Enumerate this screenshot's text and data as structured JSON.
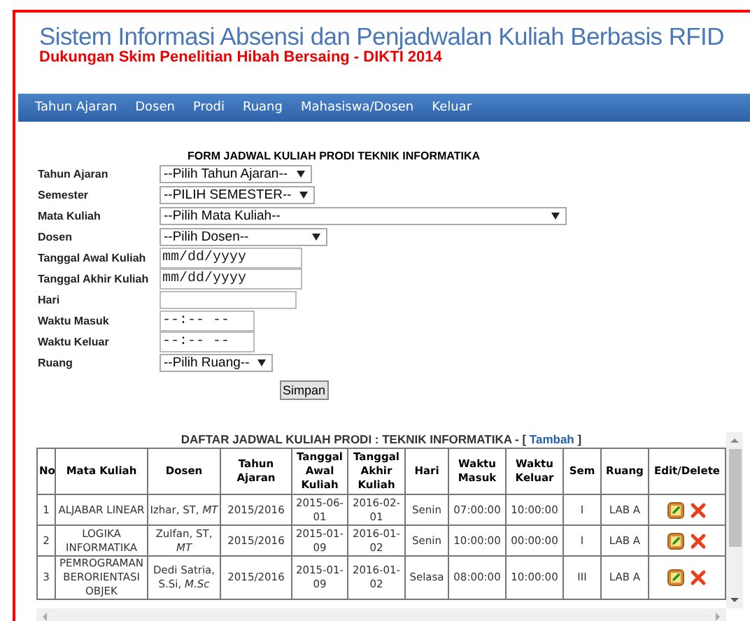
{
  "header": {
    "title": "Sistem Informasi Absensi dan Penjadwalan Kuliah Berbasis RFID",
    "subtitle": "Dukungan Skim Penelitian Hibah Bersaing - DIKTI 2014"
  },
  "nav": {
    "items": [
      "Tahun Ajaran",
      "Dosen",
      "Prodi",
      "Ruang",
      "Mahasiswa/Dosen",
      "Keluar"
    ]
  },
  "form": {
    "heading": "FORM JADWAL KULIAH PRODI TEKNIK INFORMATIKA",
    "fields": [
      {
        "label": "Tahun Ajaran",
        "kind": "select",
        "value": "--Pilih Tahun Ajaran--"
      },
      {
        "label": "Semester",
        "kind": "select",
        "value": "--PILIH SEMESTER--"
      },
      {
        "label": "Mata Kuliah",
        "kind": "select",
        "value": "--Pilih Mata Kuliah--"
      },
      {
        "label": "Dosen",
        "kind": "select",
        "value": "--Pilih Dosen--"
      },
      {
        "label": "Tanggal Awal Kuliah",
        "kind": "date",
        "placeholder": "mm/dd/yyyy"
      },
      {
        "label": "Tanggal Akhir Kuliah",
        "kind": "date",
        "placeholder": "mm/dd/yyyy"
      },
      {
        "label": "Hari",
        "kind": "text"
      },
      {
        "label": "Waktu Masuk",
        "kind": "time",
        "placeholder": "--:-- --"
      },
      {
        "label": "Waktu Keluar",
        "kind": "time",
        "placeholder": "--:-- --"
      },
      {
        "label": "Ruang",
        "kind": "select",
        "value": "--Pilih Ruang--"
      }
    ],
    "submit": "Simpan"
  },
  "table": {
    "caption": "DAFTAR JADWAL KULIAH PRODI : TEKNIK INFORMATIKA - [",
    "caption_link": "Tambah",
    "caption_end": "]",
    "columns": [
      "No",
      "Mata Kuliah",
      "Dosen",
      "Tahun Ajaran",
      "Tanggal Awal Kuliah",
      "Tanggal Akhir Kuliah",
      "Hari",
      "Waktu Masuk",
      "Waktu Keluar",
      "Sem",
      "Ruang",
      "Edit/Delete"
    ],
    "rows": [
      [
        "1",
        "ALJABAR LINEAR",
        "Izhar, ST, *MT*",
        "2015/2016",
        "2015-06-01",
        "2016-02-01",
        "Senin",
        "07:00:00",
        "10:00:00",
        "I",
        "LAB A"
      ],
      [
        "2",
        "LOGIKA INFORMATIKA",
        "Zulfan, ST, *MT*",
        "2015/2016",
        "2015-01-09",
        "2016-01-02",
        "Senin",
        "10:00:00",
        "00:00:00",
        "I",
        "LAB A"
      ],
      [
        "3",
        "PEMROGRAMAN BERORIENTASI OBJEK",
        "Dedi Satria, S.Si, *M.Sc*",
        "2015/2016",
        "2015-01-09",
        "2016-01-02",
        "Selasa",
        "08:00:00",
        "10:00:00",
        "III",
        "LAB A"
      ]
    ]
  }
}
